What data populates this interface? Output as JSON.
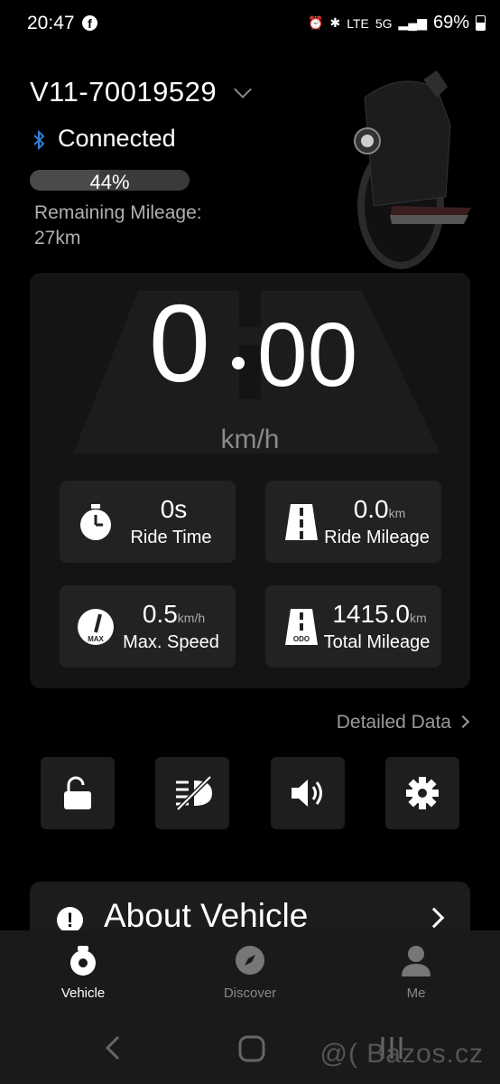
{
  "status_bar": {
    "time": "20:47",
    "battery_percent": "69%",
    "network": "5G",
    "lte": "LTE",
    "icons": [
      "facebook-icon",
      "alarm-icon",
      "bluetooth-icon",
      "volte-icon",
      "signal-icon",
      "battery-icon"
    ]
  },
  "device": {
    "name": "V11-70019529",
    "connection": "Connected",
    "battery_label": "44%",
    "battery_level": 0.44,
    "remaining_label": "Remaining Mileage:",
    "remaining_value": "27km"
  },
  "speed": {
    "integer": "0",
    "decimal": "00",
    "unit": "km/h"
  },
  "stats": [
    {
      "value": "0s",
      "unit": "",
      "label": "Ride Time",
      "icon": "stopwatch-icon"
    },
    {
      "value": "0.0",
      "unit": "km",
      "label": "Ride Mileage",
      "icon": "road-icon"
    },
    {
      "value": "0.5",
      "unit": "km/h",
      "label": "Max. Speed",
      "icon": "speedometer-max-icon",
      "icon_text": "MAX"
    },
    {
      "value": "1415.0",
      "unit": "km",
      "label": "Total Mileage",
      "icon": "road-odo-icon",
      "icon_text": "ODO"
    }
  ],
  "detailed_data": "Detailed Data",
  "quick_buttons": [
    {
      "name": "unlock-button",
      "icon": "unlock-icon"
    },
    {
      "name": "light-off-button",
      "icon": "headlight-off-icon"
    },
    {
      "name": "volume-button",
      "icon": "speaker-icon"
    },
    {
      "name": "settings-button",
      "icon": "gear-icon"
    }
  ],
  "about": {
    "label": "About Vehicle",
    "icon": "info-icon"
  },
  "bottom_nav": [
    {
      "label": "Vehicle",
      "icon": "vehicle-icon",
      "active": true
    },
    {
      "label": "Discover",
      "icon": "compass-icon",
      "active": false
    },
    {
      "label": "Me",
      "icon": "person-icon",
      "active": false
    }
  ],
  "watermark": "@( Bazos.cz",
  "colors": {
    "background": "#000000",
    "panel": "#141414",
    "card": "#222222",
    "accent_bluetooth": "#2f7fd9"
  }
}
